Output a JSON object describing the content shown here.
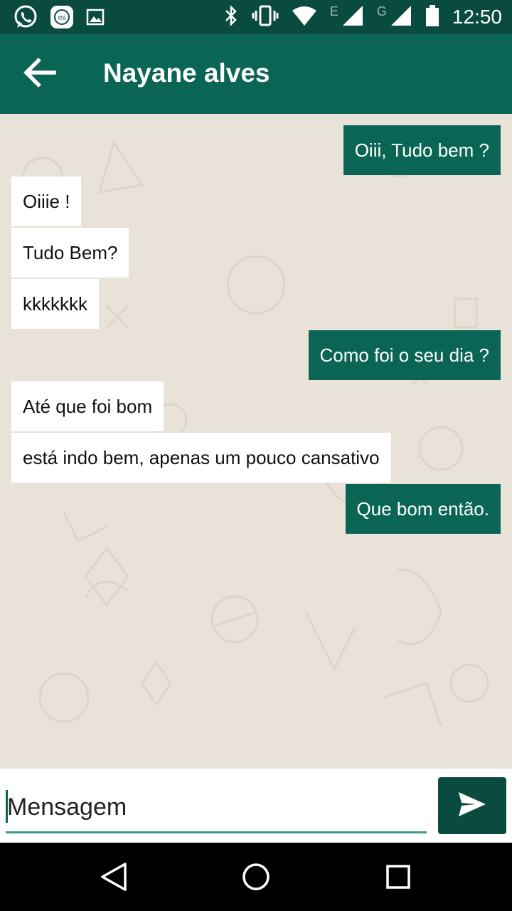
{
  "status_bar": {
    "time": "12:50",
    "network_1": "E",
    "network_2": "G",
    "left_icons": [
      "whatsapp-icon",
      "mi-icon",
      "image-icon"
    ],
    "right_icons": [
      "bluetooth-icon",
      "vibrate-icon",
      "wifi-icon",
      "signal-icon",
      "signal-icon",
      "battery-icon"
    ]
  },
  "header": {
    "contact_name": "Nayane alves",
    "back_icon": "arrow-left-icon"
  },
  "messages": [
    {
      "direction": "out",
      "text": "Oiii, Tudo bem ?"
    },
    {
      "direction": "in",
      "text": "Oiiie !"
    },
    {
      "direction": "in",
      "text": "Tudo Bem?"
    },
    {
      "direction": "in",
      "text": "kkkkkkk"
    },
    {
      "direction": "out",
      "text": "Como foi o seu dia ?"
    },
    {
      "direction": "in",
      "text": "Até que foi bom"
    },
    {
      "direction": "in",
      "text": "está indo bem, apenas um pouco cansativo"
    },
    {
      "direction": "out",
      "text": "Que bom então."
    }
  ],
  "composer": {
    "placeholder": "Mensagem",
    "value": "",
    "send_icon": "send-icon"
  },
  "navigation": [
    "back-icon",
    "home-icon",
    "recents-icon"
  ],
  "colors": {
    "status_bar": "#0a4b3f",
    "app_bar": "#0b6555",
    "outgoing_bubble": "#0b6555",
    "incoming_bubble": "#ffffff",
    "chat_background": "#e9e2d8",
    "input_underline": "#3a9d8b"
  }
}
